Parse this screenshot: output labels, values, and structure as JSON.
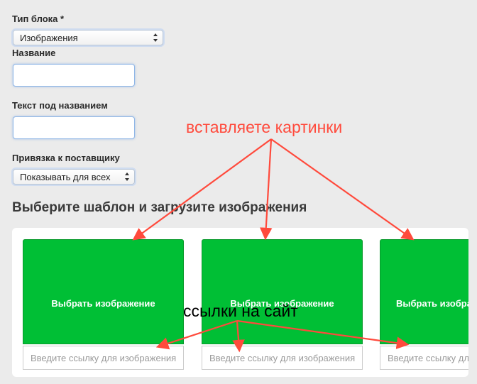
{
  "form": {
    "block_type_label": "Тип блока *",
    "block_type_value": "Изображения",
    "name_label": "Название",
    "subtitle_label": "Текст под названием",
    "supplier_label": "Привязка к поставщику",
    "supplier_value": "Показывать для всех"
  },
  "section": {
    "heading": "Выберите шаблон и загрузите изображения"
  },
  "cards": [
    {
      "button": "Выбрать изображение",
      "link_placeholder": "Введите ссылку для изображения"
    },
    {
      "button": "Выбрать изображение",
      "link_placeholder": "Введите ссылку для изображения"
    },
    {
      "button": "Выбрать изображение",
      "link_placeholder": "Введите ссылку для изображения"
    }
  ],
  "annotations": {
    "insert_images": "вставляете картинки",
    "site_links": "ссылки на сайт"
  },
  "colors": {
    "card_green": "#00bf35",
    "arrow_red": "#ff4a3c"
  }
}
